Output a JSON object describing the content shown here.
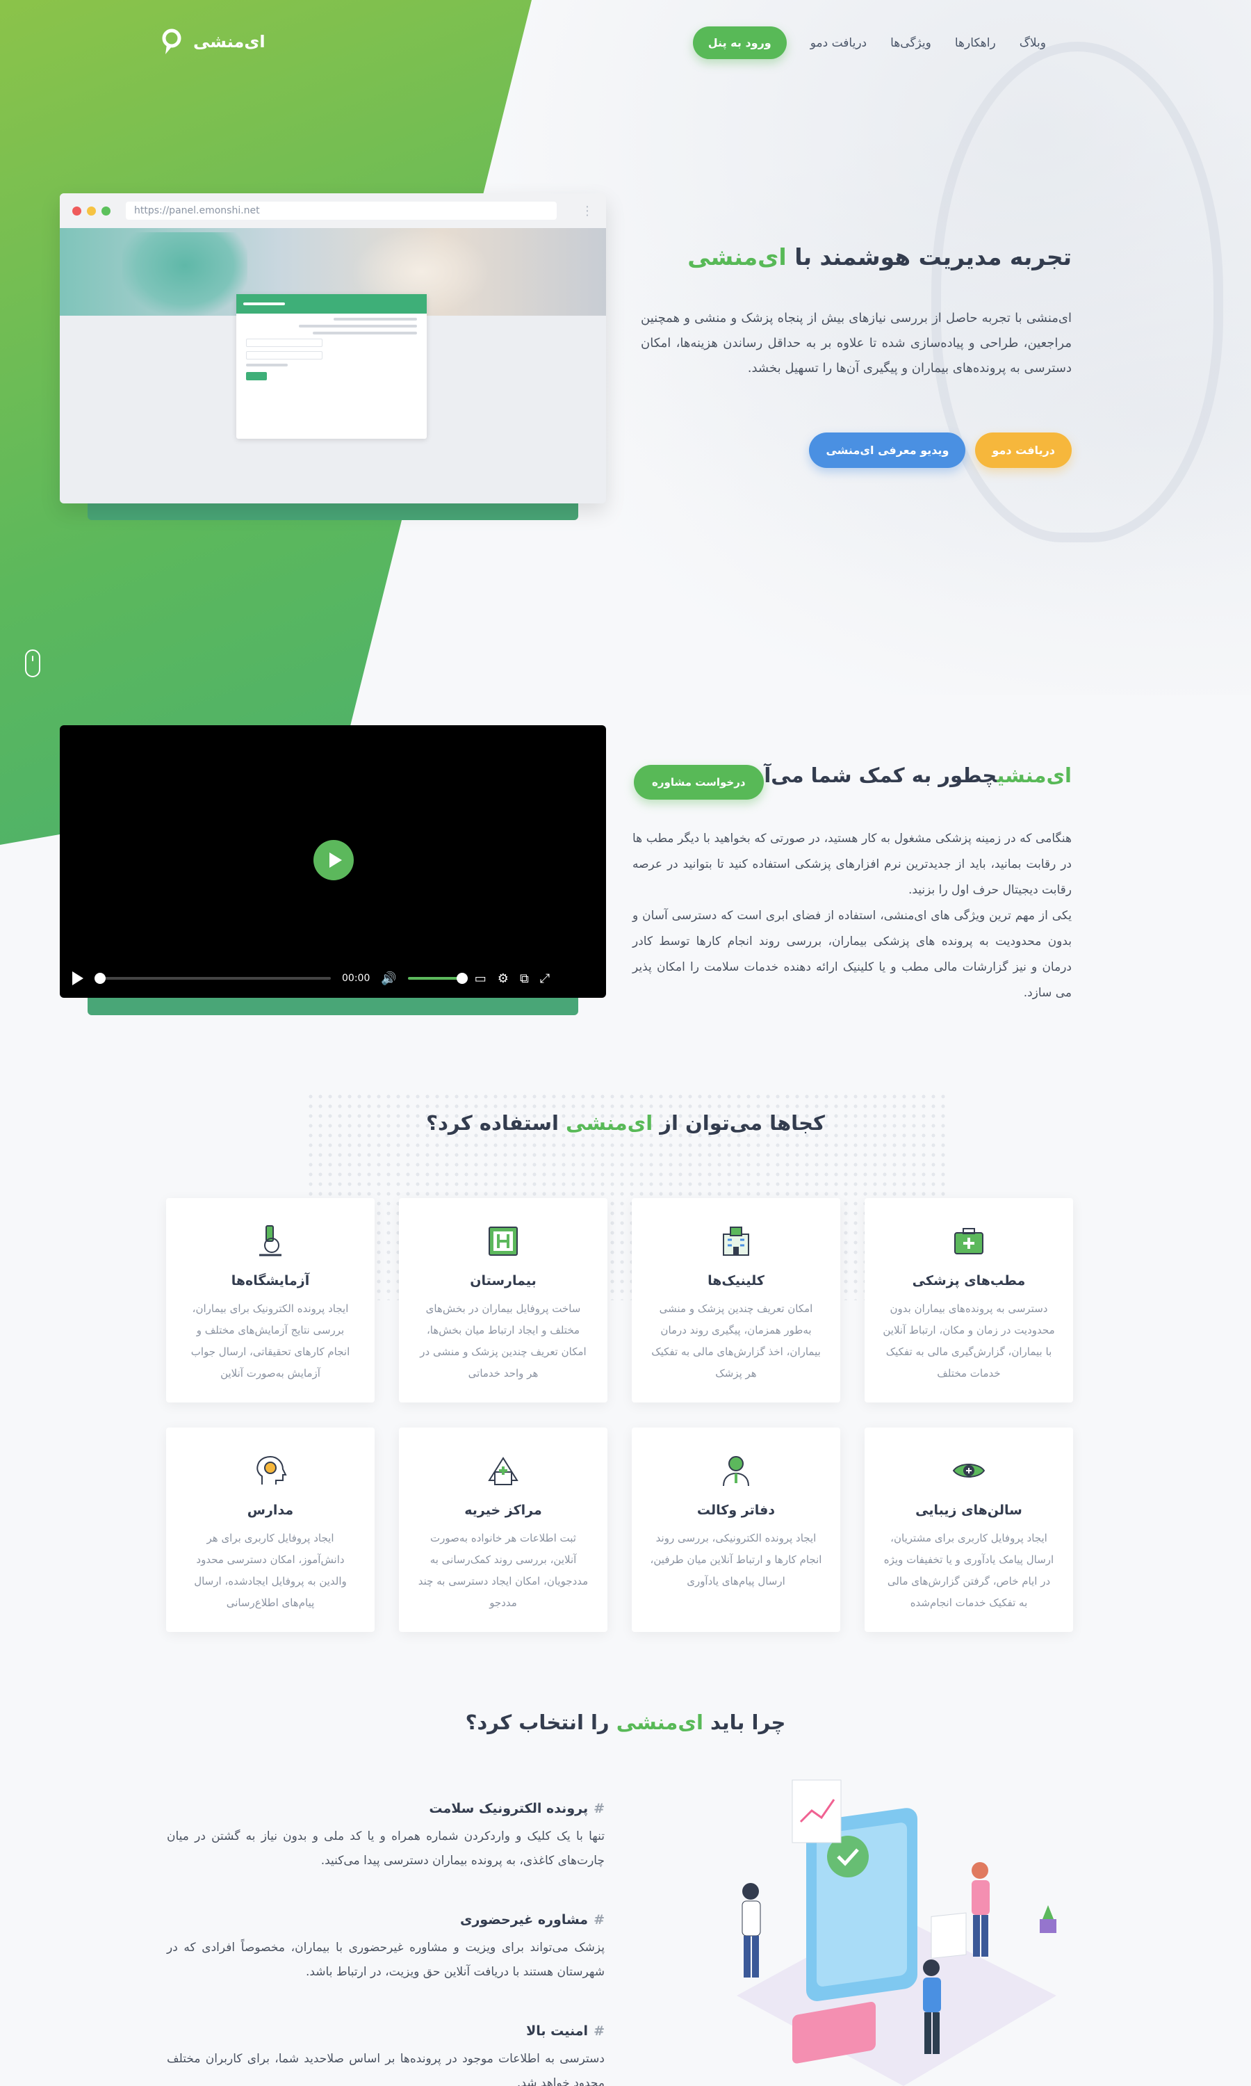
{
  "header": {
    "logo_text": "ای‌منشی",
    "nav": [
      "وبلاگ",
      "راهکارها",
      "ویژگی‌ها",
      "دریافت دمو"
    ],
    "login_button": "ورود به پنل"
  },
  "hero": {
    "title_prefix": "تجربه مدیریت هوشمند با",
    "title_brand": "ای‌منشی",
    "description": "ای‌منشی با تجربه حاصل از بررسی نیازهای بیش از پنجاه پزشک و منشی و همچنین مراجعین، طراحی و پیاده‌سازی شده تا علاوه بر به حداقل رساندن هزینه‌ها، امکان دسترسی به پرونده‌های بیماران و پیگیری آن‌ها را تسهیل بخشد.",
    "demo_button": "دریافت دمو",
    "video_button": "ویدیو معرفی ای‌منشی",
    "browser_url": "https://panel.emonshi.net"
  },
  "help": {
    "title_brand": "ای‌منشی",
    "title_rest": "چطور به کمک شما می‌آید؟",
    "consult_button": "درخواست مشاوره",
    "paragraph1": "هنگامی که در زمینه پزشکی مشغول به کار هستید، در صورتی که بخواهید با دیگر مطب ها در رقابت بمانید، باید از جدیدترین نرم افزارهای پزشکی استفاده کنید تا بتوانید در عرصه رقابت دیجیتال حرف اول را بزنید.",
    "paragraph2": "یکی از مهم ترین ویژگی های ای‌منشی، استفاده از فضای ابری است که دسترسی آسان و بدون محدودیت به پرونده های پزشکی بیماران، بررسی روند انجام کارها توسط کادر درمان و نیز گزارشات مالی مطب و یا کلینیک ارائه دهنده خدمات سلامت را امکان پذیر می سازد.",
    "video_time": "00:00"
  },
  "where": {
    "title_prefix": "کجاها می‌توان از",
    "title_brand": "ای‌منشی",
    "title_suffix": "استفاده کرد؟",
    "cards": [
      {
        "title": "مطب‌های پزشکی",
        "desc": "دسترسی به پرونده‌های بیماران بدون محدودیت در زمان و مکان، ارتباط آنلاین با بیماران، گزارش‌گیری مالی به تفکیک خدمات مختلف",
        "icon": "medkit-icon"
      },
      {
        "title": "کلینیک‌ها",
        "desc": "امکان تعریف چندین پزشک و منشی به‌طور همزمان، پیگیری روند درمان بیماران، اخذ گزارش‌های مالی به تفکیک هر پزشک",
        "icon": "clinic-building-icon"
      },
      {
        "title": "بیمارستان",
        "desc": "ساخت پروفایل بیماران در بخش‌های مختلف و ایجاد ارتباط میان بخش‌ها، امکان تعریف چندین پزشک و منشی در هر واحد خدماتی",
        "icon": "hospital-icon"
      },
      {
        "title": "آزمایشگاه‌ها",
        "desc": "ایجاد پرونده الکترونیک برای بیماران، بررسی نتایج آزمایش‌های مختلف و انجام کارهای تحقیقاتی، ارسال جواب آزمایش به‌صورت آنلاین",
        "icon": "microscope-icon"
      },
      {
        "title": "سالن‌های زیبایی",
        "desc": "ایجاد پروفایل کاربری برای مشتریان، ارسال پیامک یادآوری و یا تخفیفات ویژه در ایام خاص، گرفتن گزارش‌های مالی به تفکیک خدمات انجام‌شده",
        "icon": "eye-care-icon"
      },
      {
        "title": "دفاتر وکالت",
        "desc": "ایجاد پرونده الکترونیکی، بررسی روند انجام کارها و ارتباط آنلاین میان طرفین، ارسال پیام‌های یادآوری",
        "icon": "lawyer-icon"
      },
      {
        "title": "مراکز خیریه",
        "desc": "ثبت اطلاعات هر خانواده به‌صورت آنلاین، بررسی روند کمک‌رسانی به مددجویان، امکان ایجاد دسترسی به چند مددجو",
        "icon": "charity-icon"
      },
      {
        "title": "مدارس",
        "desc": "ایجاد پروفایل کاربری برای هر دانش‌آموز، امکان دسترسی محدود والدین به پروفایل ایجادشده، ارسال پیام‌های اطلاع‌رسانی",
        "icon": "head-brain-icon"
      }
    ]
  },
  "why": {
    "title_prefix": "چرا باید",
    "title_brand": "ای‌منشی",
    "title_suffix": "را انتخاب کرد؟",
    "features": [
      {
        "title": "پرونده الکترونیک سلامت",
        "desc": "تنها با یک کلیک و واردکردن شماره همراه و یا کد ملی و بدون نیاز به گشتن در میان چارت‌های کاغذی، به پرونده بیماران دسترسی پیدا می‌کنید."
      },
      {
        "title": "مشاوره غیرحضوری",
        "desc": "پزشک می‌تواند برای ویزیت و مشاوره غیرحضوری با بیماران، مخصوصاً افرادی که در شهرستان هستند با دریافت آنلاین حق ویزیت، در ارتباط باشد."
      },
      {
        "title": "امنیت بالا",
        "desc": "دسترسی به اطلاعات موجود در پرونده‌ها بر اساس صلاحدید شما، برای کاربران مختلف محدود خواهد شد."
      }
    ]
  },
  "colors": {
    "brand_green": "#58b957",
    "demo_yellow": "#f6b73c",
    "video_blue": "#4a90e2"
  }
}
